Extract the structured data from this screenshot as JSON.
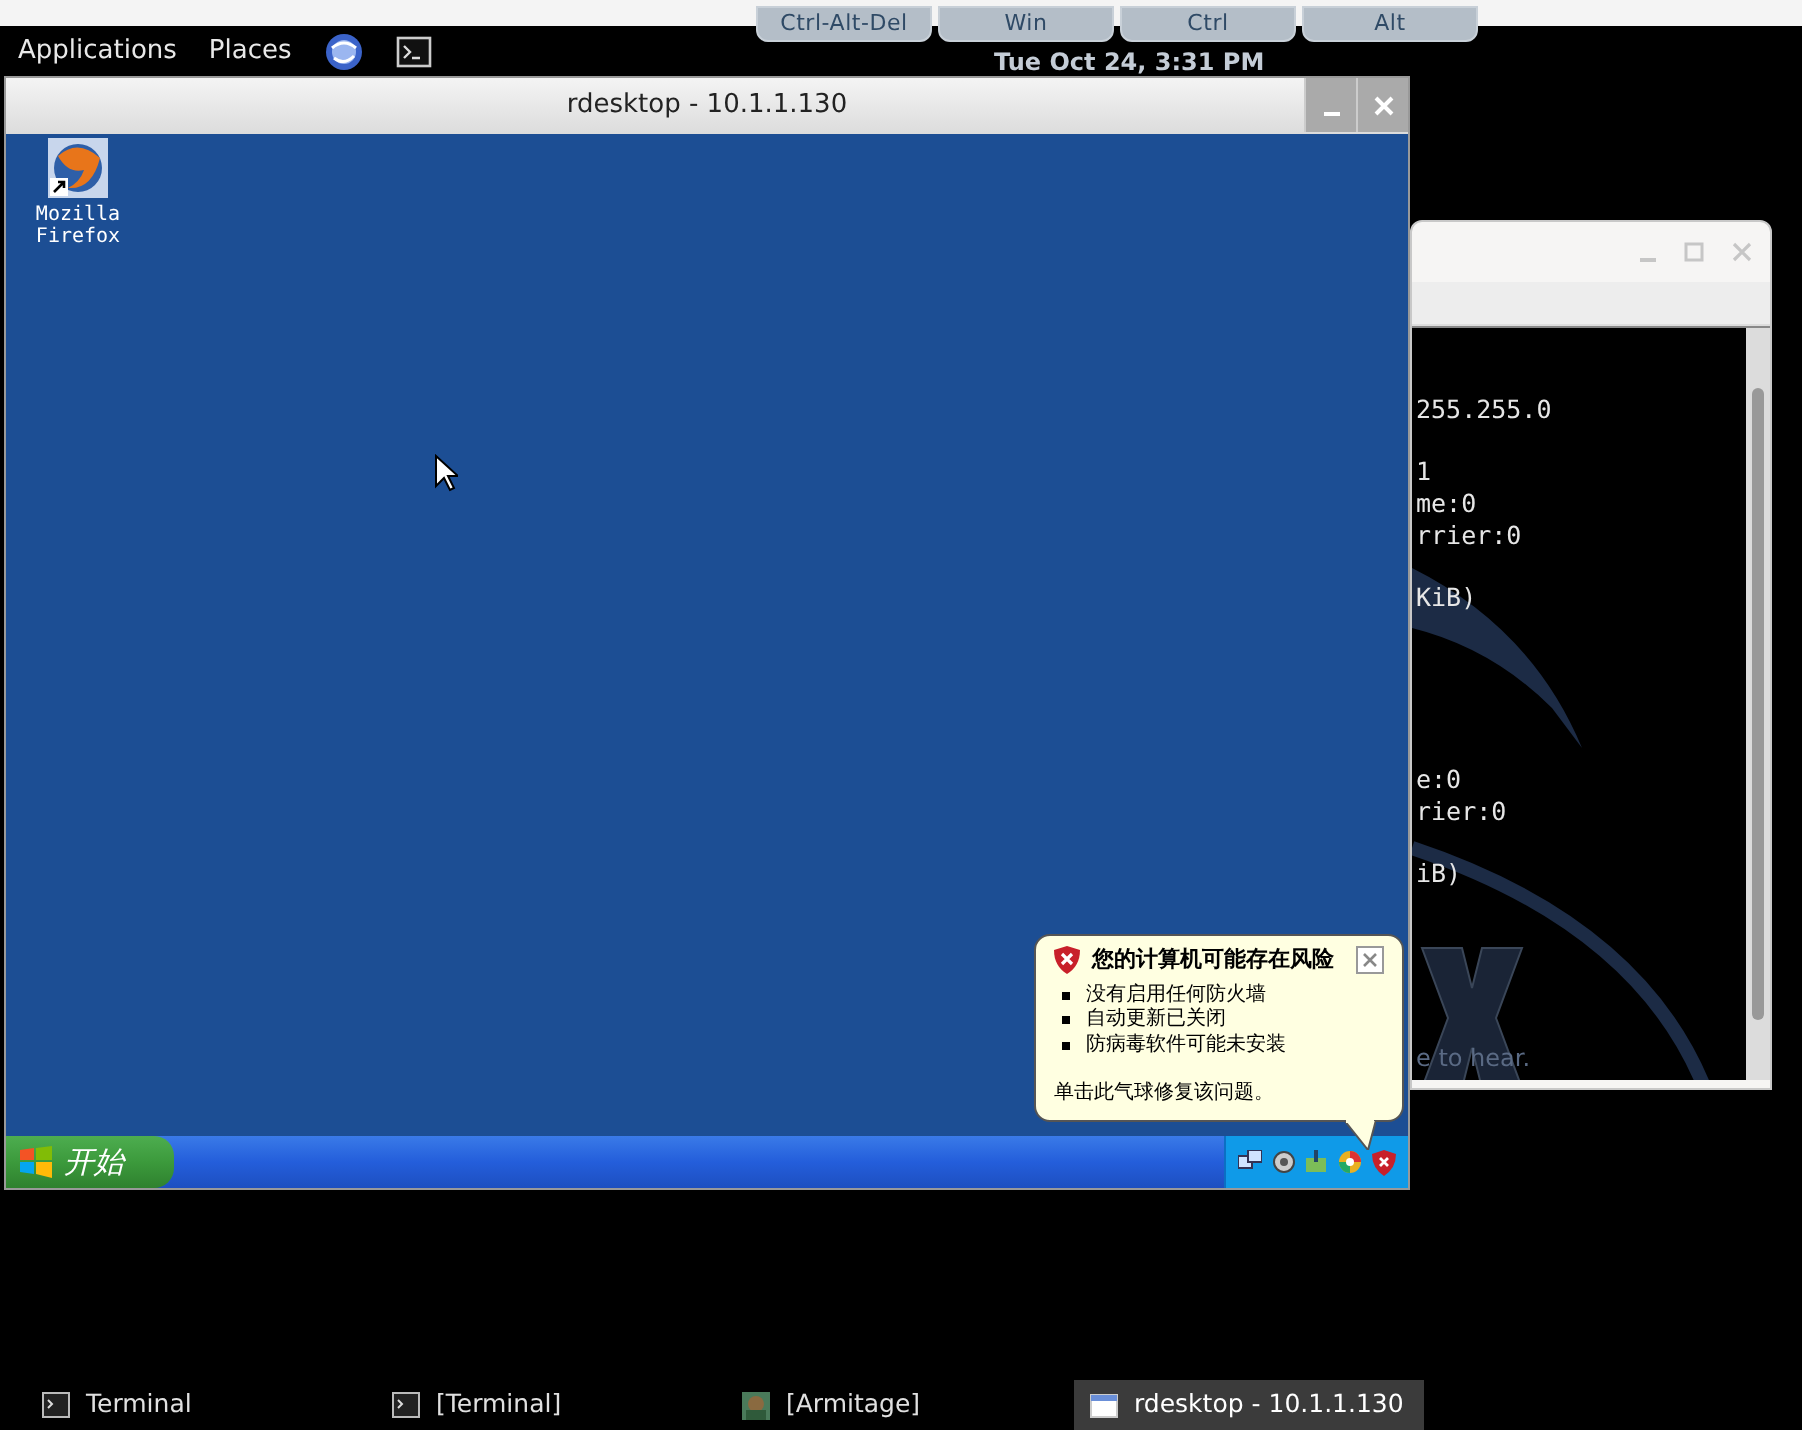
{
  "top_panel": {
    "menus": [
      "Applications",
      "Places"
    ],
    "clock": "Tue Oct 24,  3:31 PM"
  },
  "onscreen_keys": [
    "Ctrl-Alt-Del",
    "Win",
    "Ctrl",
    "Alt"
  ],
  "terminal_window": {
    "lines": [
      {
        "text": "255.255.0"
      },
      {
        "text": "1"
      },
      {
        "text": "me:0"
      },
      {
        "text": "rrier:0"
      },
      {
        "text": "KiB)"
      },
      {
        "text": "e:0"
      },
      {
        "text": "rier:0"
      },
      {
        "text": "iB)"
      }
    ],
    "wallpaper_text": "e to hear."
  },
  "rdesktop_window": {
    "title": "rdesktop - 10.1.1.130",
    "desktop_icons": [
      {
        "label": "Mozilla Firefox"
      }
    ],
    "start_button": "开始",
    "balloon": {
      "title": "您的计算机可能存在风险",
      "bullets": [
        "没有启用任何防火墙",
        "自动更新已关闭",
        "防病毒软件可能未安装"
      ],
      "footer": "单击此气球修复该问题。"
    }
  },
  "taskbar": [
    {
      "label": "Terminal",
      "kind": "terminal",
      "selected": false
    },
    {
      "label": "[Terminal]",
      "kind": "terminal",
      "selected": false
    },
    {
      "label": "[Armitage]",
      "kind": "armitage",
      "selected": false
    },
    {
      "label": "rdesktop - 10.1.1.130",
      "kind": "window",
      "selected": true
    }
  ]
}
